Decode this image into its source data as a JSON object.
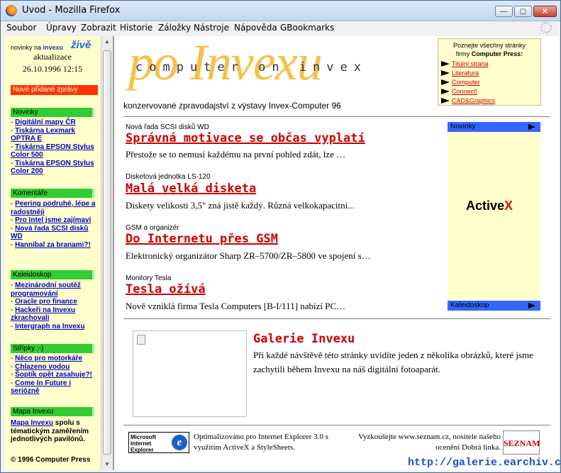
{
  "window": {
    "title": "Uvod - Mozilla Firefox",
    "buttons": {
      "minimize": "—",
      "maximize": "▢",
      "close": "✕"
    }
  },
  "menu": [
    "Soubor",
    "Úpravy",
    "Zobrazit",
    "Historie",
    "Záložky",
    "Nástroje",
    "Nápověda",
    "GBookmarks"
  ],
  "left": {
    "logo_prefix": "novinky na ",
    "logo_brand": "invexu",
    "logo_live": "živě",
    "update_label": "aktualizace",
    "update_time": "26.10.1996 12:15",
    "new_news_label": "Nové přidané zprávy",
    "sections": [
      {
        "title": "Novinky",
        "items": [
          "Digitální mapy ČR",
          "Tiskárna Lexmark OPTRA E",
          "Tiskárna EPSON Stylus Color 500",
          "Tiskárna EPSON Stylus Color 200"
        ]
      },
      {
        "title": "Komentáře",
        "items": [
          "Peering podruhé, lépe a radostněji",
          "Pro Intel jsme zajímaví",
          "Nová řada SCSI disků WD",
          "Hannibal za branami?!"
        ]
      },
      {
        "title": "Kaleidoskop",
        "items": [
          "Mezinárodní soutěž programování",
          "Oracle pro finance",
          "Hackeři na Invexu zkrachovali",
          "Intergraph na Invexu"
        ]
      },
      {
        "title": "Střípky :-)",
        "items": [
          "Něco pro motorkáře",
          "Chlazeno vodou",
          "Šoptík opět zasahuje?!",
          "Come In Future i seriózně"
        ]
      }
    ],
    "mapa": {
      "title": "Mapa Invexu",
      "link": "Mapa Invexu",
      "text": " spolu s tématickým zaměřením jednotlivých pavilónů."
    },
    "copyright": "© 1996 Computer Press"
  },
  "main": {
    "title_big": "po Invexu",
    "title_sub": "computer on invex",
    "tagline": "konzervované zpravodajství z výstavy Invex-Computer 96",
    "cp_box": {
      "line1": "Poznejte všechny stránky",
      "line2_prefix": "firmy ",
      "line2_bold": "Computer Press:",
      "links": [
        "Titulní strana",
        "Literatura",
        "Computer",
        "Connect!",
        "CAD&Graphics"
      ]
    },
    "news": [
      {
        "category": "Nová řada SCSI disků WD",
        "headline": "Správná motivace se občas vyplatí",
        "excerpt": "Přestože se to nemusí každému na první pohled zdát, lze …"
      },
      {
        "category": "Disketová jednotka LS-120",
        "headline": "Malá velká disketa",
        "excerpt": "Diskety velikosti 3,5\" zná jistě každý. Různá velkokapacitní..."
      },
      {
        "category": "GSM a organizér",
        "headline": "Do Internetu přes GSM",
        "excerpt": "Elektronický organizátor Sharp ZR–5700/ZR–5800 ve spojení s…"
      },
      {
        "category": "Monitory Tesla",
        "headline": "Tesla ožívá",
        "excerpt": "Nově vzniklá firma Tesla Computers [B-I/111] nabízí PC…"
      }
    ],
    "ad": {
      "top_label": "Novinky",
      "bottom_label": "Kaleidoskop",
      "brand": "Active",
      "brand_x": "X"
    },
    "gallery": {
      "title": "Galerie Invexu",
      "text": "Při každé návštěvě této stránky uvidíte jeden z několika obrázků, které jsme zachytili během Invexu na náš digitální fotoaparát."
    },
    "footer": {
      "ie_badge": "Microsoft Internet Explorer",
      "ie_letter": "e",
      "optimized": "Optimalizováno pro Internet Explorer 3.0 s využitím ActiveX a StyleSheets.",
      "seznam_text": "Vyzkoušejte www.seznam.cz, nositele našeho ocenění Dobrá linka.",
      "seznam_logo": "SEZNAM"
    }
  },
  "watermark": "http://galerie.earchiv.cz"
}
